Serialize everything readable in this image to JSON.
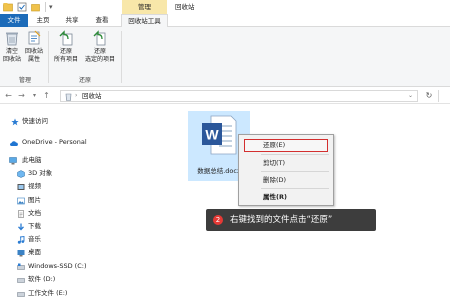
{
  "titlebar": {
    "manage_tab": "管理",
    "window_title": "回收站"
  },
  "tabs": [
    {
      "label": "文件"
    },
    {
      "label": "主页"
    },
    {
      "label": "共享"
    },
    {
      "label": "查看"
    },
    {
      "label": "回收站工具"
    }
  ],
  "ribbon": {
    "empty_bin": {
      "line1": "清空",
      "line2": "回收站"
    },
    "bin_properties": {
      "line1": "回收站",
      "line2": "属性"
    },
    "restore_all": {
      "line1": "还原",
      "line2": "所有项目"
    },
    "restore_selected": {
      "line1": "还原",
      "line2": "选定的项目"
    },
    "group_manage": "管理",
    "group_restore": "还原"
  },
  "address": {
    "path": "回收站"
  },
  "navpane": {
    "items": [
      {
        "label": "快速访问",
        "icon": "star-icon"
      },
      {
        "label": "OneDrive - Personal",
        "icon": "cloud-icon"
      },
      {
        "label": "此电脑",
        "icon": "computer-icon"
      },
      {
        "label": "3D 对象",
        "icon": "cube-icon"
      },
      {
        "label": "视频",
        "icon": "video-icon"
      },
      {
        "label": "图片",
        "icon": "picture-icon"
      },
      {
        "label": "文档",
        "icon": "document-icon"
      },
      {
        "label": "下载",
        "icon": "download-icon"
      },
      {
        "label": "音乐",
        "icon": "music-icon"
      },
      {
        "label": "桌面",
        "icon": "desktop-icon"
      },
      {
        "label": "Windows-SSD (C:)",
        "icon": "drive-icon"
      },
      {
        "label": "软件 (D:)",
        "icon": "drive-icon"
      },
      {
        "label": "工作文件 (E:)",
        "icon": "drive-icon"
      }
    ]
  },
  "file": {
    "name": "数据总结.docx",
    "icon": "word-document-icon",
    "icon_letter": "W"
  },
  "context_menu": {
    "items": [
      {
        "label": "还原(E)"
      },
      {
        "label": "剪切(T)"
      },
      {
        "label": "删除(D)"
      },
      {
        "label": "属性(R)"
      }
    ]
  },
  "callout": {
    "step": "2",
    "text": "右键找到的文件点击“还原”"
  },
  "colors": {
    "file_tab": "#1c6bb9",
    "manage_tab": "#f8e7a9",
    "selection": "#cce8ff",
    "highlight_border": "#d32f2f",
    "callout_bg": "#3d3d3d",
    "badge": "#e53935"
  }
}
